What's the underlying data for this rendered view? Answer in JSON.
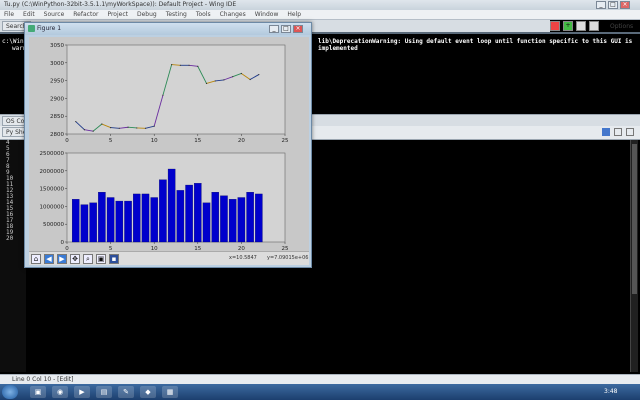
{
  "ide": {
    "title": "Tu.py (C:\\WinPython-32bit-3.5.1.1\\myWorkSpace)): Default Project - Wing IDE",
    "menu": [
      "File",
      "Edit",
      "Source",
      "Refactor",
      "Project",
      "Debug",
      "Testing",
      "Tools",
      "Changes",
      "Window",
      "Help"
    ],
    "options_label": "Options",
    "tabs_top": "Search",
    "tab_mid": "OS Comm",
    "tab_py": "Py Shell"
  },
  "console": {
    "line1_prefix": "c:\\Win",
    "line1_msg": "lib\\DeprecationWarning: Using default event loop until function specific to this GUI is implemented",
    "line2": "warn"
  },
  "gutter": {
    "numbers": [
      "4",
      "5",
      "6",
      "7",
      "8",
      "9",
      "10",
      "11",
      "12",
      "13",
      "14",
      "15",
      "16",
      "17",
      "18",
      "19",
      "20"
    ]
  },
  "status": {
    "text": "Line 0 Col 10 - [Edit]"
  },
  "taskbar": {
    "time": "3:48"
  },
  "figure": {
    "title": "Figure 1",
    "coord_x": "x=10.5847",
    "coord_y": "y=7.09015e+06"
  },
  "chart_data": [
    {
      "type": "line",
      "x": [
        1,
        2,
        3,
        4,
        5,
        6,
        7,
        8,
        9,
        10,
        11,
        12,
        13,
        14,
        15,
        16,
        17,
        18,
        19,
        20,
        21,
        22
      ],
      "series": [
        {
          "values": [
            2835,
            2812,
            2808,
            2828,
            2818,
            2816,
            2819,
            2817,
            2816,
            2822,
            2909,
            2995,
            2993,
            2993,
            2990,
            2942,
            2949,
            2952,
            2961,
            2970,
            2953,
            2967
          ]
        }
      ],
      "xlim": [
        0,
        25
      ],
      "ylim": [
        2800,
        3050
      ],
      "xticks": [
        "0",
        "5",
        "10",
        "15",
        "20",
        "25"
      ],
      "yticks": [
        "2800",
        "2850",
        "2900",
        "2950",
        "3000",
        "3050"
      ]
    },
    {
      "type": "bar",
      "x": [
        1,
        2,
        3,
        4,
        5,
        6,
        7,
        8,
        9,
        10,
        11,
        12,
        13,
        14,
        15,
        16,
        17,
        18,
        19,
        20,
        21,
        22
      ],
      "values": [
        1200000,
        1050000,
        1100000,
        1400000,
        1250000,
        1150000,
        1150000,
        1350000,
        1350000,
        1250000,
        1750000,
        2050000,
        1450000,
        1600000,
        1650000,
        1100000,
        1400000,
        1300000,
        1200000,
        1250000,
        1400000,
        1350000
      ],
      "color": "#0000cc",
      "xlim": [
        0,
        25
      ],
      "ylim": [
        0,
        2500000
      ],
      "xticks": [
        "0",
        "5",
        "10",
        "15",
        "20",
        "25"
      ],
      "yticks": [
        "0",
        "500000",
        "1000000",
        "1500000",
        "2000000",
        "2500000"
      ]
    }
  ]
}
